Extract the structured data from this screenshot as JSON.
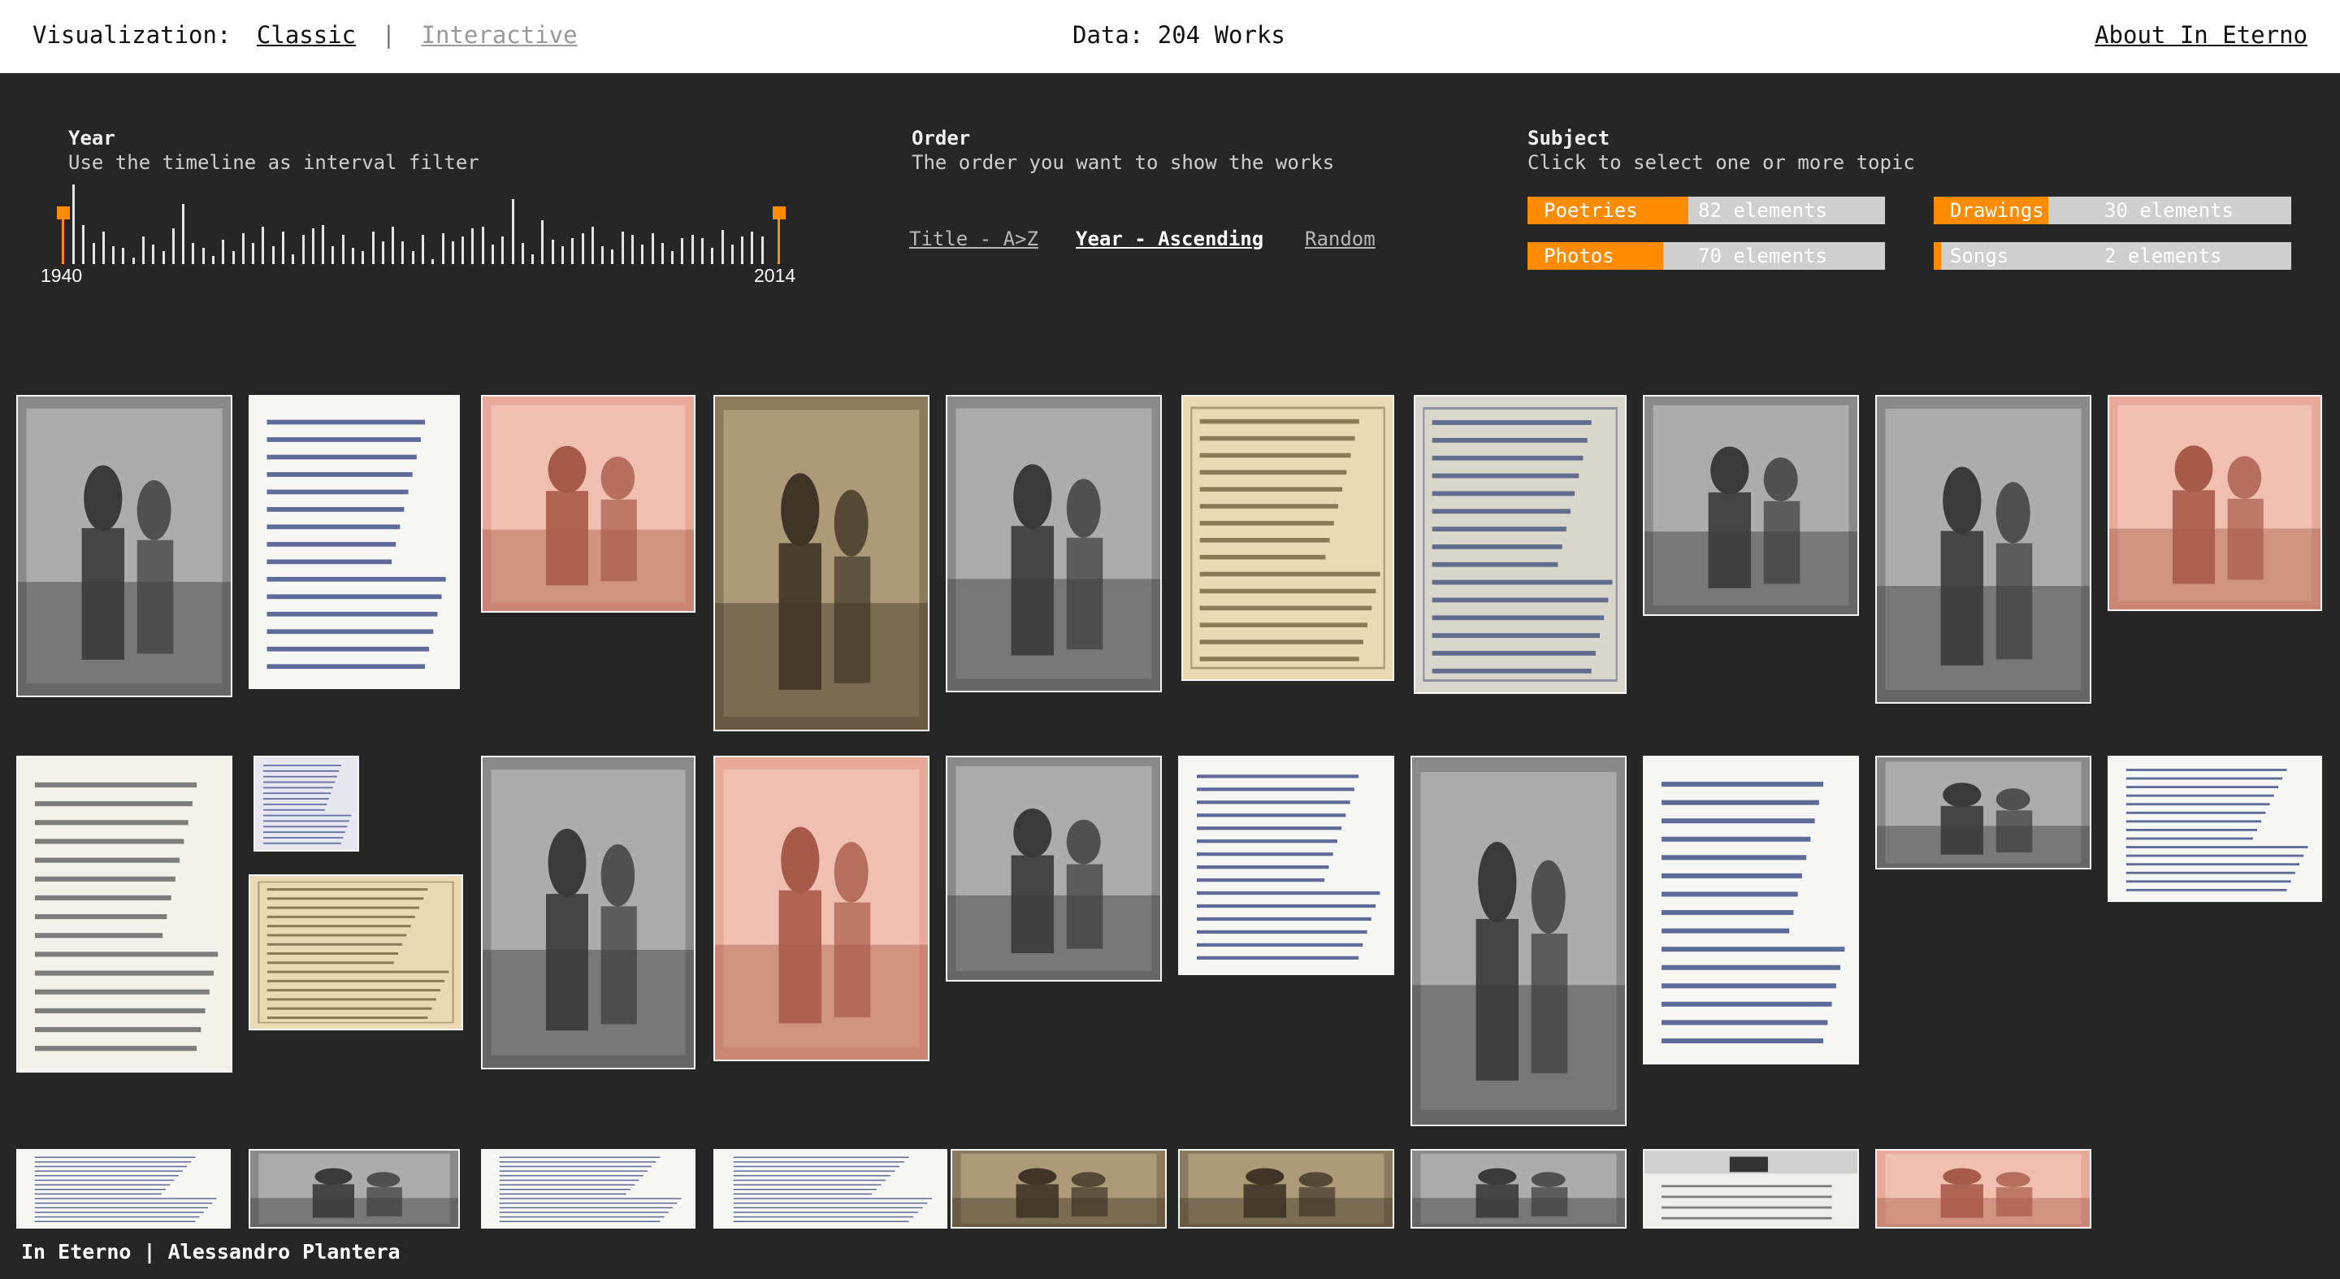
{
  "topbar": {
    "viz_label": "Visualization:",
    "classic": "Classic",
    "separator": "|",
    "interactive": "Interactive",
    "data_count": "Data: 204 Works",
    "about": "About In Eterno"
  },
  "year_filter": {
    "title": "Year",
    "subtitle": "Use the timeline as interval filter",
    "start_year": "1940",
    "end_year": "2014",
    "handle_color": "#ff8c00"
  },
  "order": {
    "title": "Order",
    "subtitle": "The order you want to show the works",
    "options": [
      "Title - A>Z",
      "Year - Ascending",
      "Random"
    ],
    "selected": "Year - Ascending"
  },
  "subject": {
    "title": "Subject",
    "subtitle": "Click to select one or more topic",
    "topics": [
      {
        "name": "Poetries",
        "count": "82 elements",
        "fill_fraction": 0.45
      },
      {
        "name": "Drawings",
        "count": "30 elements",
        "fill_fraction": 0.32
      },
      {
        "name": "Photos",
        "count": "70 elements",
        "fill_fraction": 0.38
      },
      {
        "name": "Songs",
        "count": "2 elements",
        "fill_fraction": 0.02
      }
    ],
    "accent_color": "#ff8c00"
  },
  "works": [
    {
      "name": "work-couple-photo",
      "kind": "photo-bw"
    },
    {
      "name": "work-handwritten-poem",
      "kind": "handwriting"
    },
    {
      "name": "work-car-picnic-photo",
      "kind": "photo-faded"
    },
    {
      "name": "work-man-walking-photo",
      "kind": "photo-sepia"
    },
    {
      "name": "work-wedding-photo",
      "kind": "photo-bw"
    },
    {
      "name": "work-form-document",
      "kind": "document-yellow"
    },
    {
      "name": "work-telegram",
      "kind": "telegram"
    },
    {
      "name": "work-child-garden-photo",
      "kind": "photo-bw"
    },
    {
      "name": "work-father-baby-photo",
      "kind": "photo-bw"
    },
    {
      "name": "work-seaside-photo",
      "kind": "photo-faded"
    },
    {
      "name": "work-typed-document",
      "kind": "document-white"
    },
    {
      "name": "work-postcard-letter",
      "kind": "letters"
    },
    {
      "name": "work-lyrics-sheet",
      "kind": "document-yellow"
    },
    {
      "name": "work-wedding-group-photo",
      "kind": "photo-bw"
    },
    {
      "name": "work-red-car-photo",
      "kind": "photo-faded"
    },
    {
      "name": "work-woman-sitting-photo",
      "kind": "photo-bw"
    },
    {
      "name": "work-grid-paper-poem",
      "kind": "handwriting"
    },
    {
      "name": "work-wedding-exit-photo",
      "kind": "photo-bw"
    },
    {
      "name": "work-short-letter",
      "kind": "handwriting"
    },
    {
      "name": "work-woman-reclining-photo",
      "kind": "photo-bw"
    },
    {
      "name": "work-notebook-page",
      "kind": "handwriting"
    },
    {
      "name": "work-long-letter",
      "kind": "handwriting"
    },
    {
      "name": "work-landscape-photo",
      "kind": "photo-bw"
    },
    {
      "name": "work-torn-note",
      "kind": "handwriting"
    },
    {
      "name": "work-dated-note",
      "kind": "handwriting"
    },
    {
      "name": "work-group-outdoor-photo",
      "kind": "photo-sepia"
    },
    {
      "name": "work-class-photo",
      "kind": "photo-sepia"
    },
    {
      "name": "work-soldiers-photo",
      "kind": "photo-bw"
    },
    {
      "name": "work-calendar-page",
      "kind": "calendar"
    },
    {
      "name": "work-field-photo",
      "kind": "photo-faded"
    }
  ],
  "footer": {
    "credit": "In Eterno | Alessandro Plantera"
  }
}
